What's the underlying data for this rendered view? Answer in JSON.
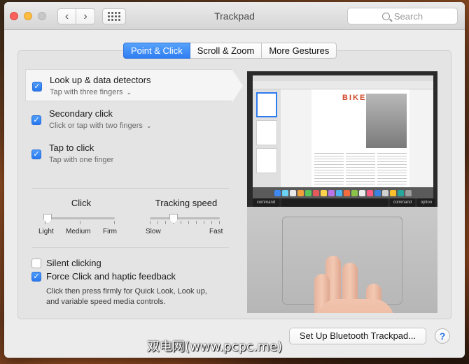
{
  "window": {
    "title": "Trackpad"
  },
  "toolbar": {
    "search_placeholder": "Search"
  },
  "tabs": [
    {
      "label": "Point & Click",
      "active": true
    },
    {
      "label": "Scroll & Zoom",
      "active": false
    },
    {
      "label": "More Gestures",
      "active": false
    }
  ],
  "options": [
    {
      "title": "Look up & data detectors",
      "subtitle": "Tap with three fingers",
      "has_menu": true,
      "checked": true,
      "selected": true
    },
    {
      "title": "Secondary click",
      "subtitle": "Click or tap with two fingers",
      "has_menu": true,
      "checked": true,
      "selected": false
    },
    {
      "title": "Tap to click",
      "subtitle": "Tap with one finger",
      "has_menu": false,
      "checked": true,
      "selected": false
    }
  ],
  "sliders": {
    "click": {
      "label": "Click",
      "ticks": [
        "Light",
        "Medium",
        "Firm"
      ],
      "value_fraction": 0.0
    },
    "tracking": {
      "label": "Tracking speed",
      "ticks": [
        "Slow",
        "Fast"
      ],
      "value_fraction": 0.33
    }
  },
  "checkboxes": {
    "silent_clicking": {
      "label": "Silent clicking",
      "checked": false
    },
    "force_click": {
      "label": "Force Click and haptic feedback",
      "checked": true,
      "description_line1": "Click then press firmly for Quick Look, Look up,",
      "description_line2": "and variable speed media controls."
    }
  },
  "preview": {
    "page_heading": "BIKES",
    "key_left": "command",
    "key_right1": "command",
    "key_right2": "option"
  },
  "buttons": {
    "setup_bluetooth": "Set Up Bluetooth Trackpad...",
    "help": "?"
  },
  "watermark": "双电网(www.pcpc.me)",
  "colors": {
    "accent": "#2f7ef2",
    "close": "#fc615d",
    "minimize": "#fdbc40"
  }
}
